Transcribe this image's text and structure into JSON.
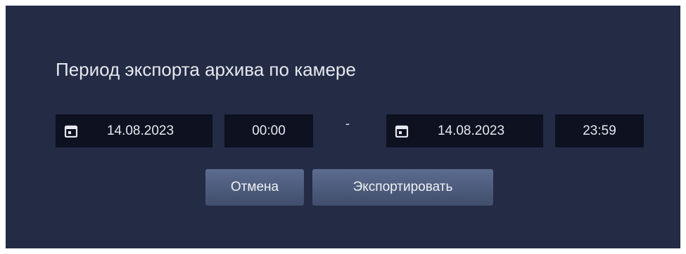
{
  "dialog": {
    "title": "Период экспорта архива по камере",
    "start": {
      "date": "14.08.2023",
      "time": "00:00"
    },
    "separator": "-",
    "end": {
      "date": "14.08.2023",
      "time": "23:59"
    },
    "buttons": {
      "cancel_label": "Отмена",
      "export_label": "Экспортировать"
    }
  },
  "colors": {
    "dialog_bg": "#232b45",
    "field_bg": "#0d1120",
    "text": "#e6e8ee",
    "button_top": "#5c6c8f",
    "button_bottom": "#414e6c"
  },
  "icons": [
    "calendar-icon",
    "calendar-icon"
  ]
}
